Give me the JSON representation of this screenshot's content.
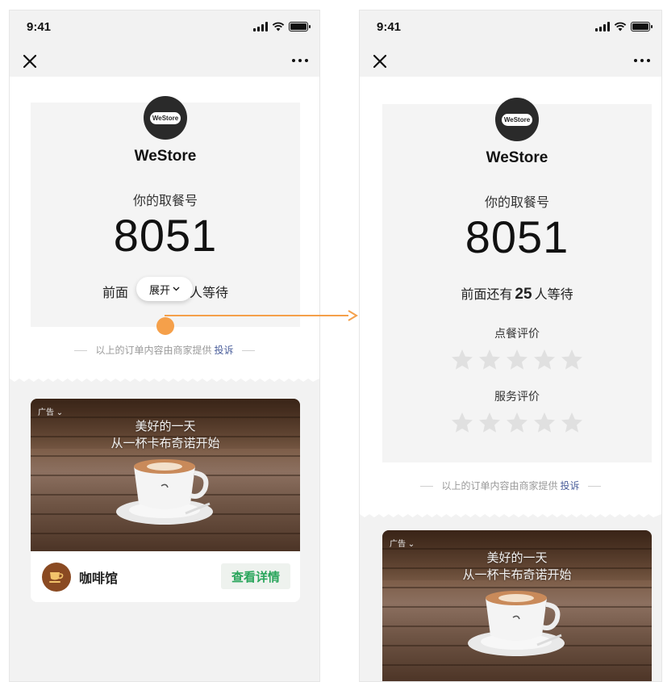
{
  "status_bar": {
    "time": "9:41"
  },
  "store": {
    "name": "WeStore",
    "logo_text": "WeStore"
  },
  "ticket": {
    "number_label": "你的取餐号",
    "number": "8051",
    "queue_prefix_left": "前面",
    "queue_suffix_left": "人等待",
    "queue_prefix": "前面还有",
    "queue_count": "25",
    "queue_suffix": "人等待"
  },
  "expand_button": {
    "label": "展开"
  },
  "ratings": {
    "order_label": "点餐评价",
    "service_label": "服务评价",
    "order_stars": 0,
    "service_stars": 0,
    "max_stars": 5
  },
  "disclaimer": {
    "text": "以上的订单内容由商家提供",
    "link": "投诉"
  },
  "ad": {
    "tag": "广告",
    "slogan_line1": "美好的一天",
    "slogan_line2": "从一杯卡布奇诺开始",
    "shop_name": "咖啡馆",
    "cta_label": "查看详情"
  },
  "colors": {
    "accent_green": "#2aa55c",
    "link_blue": "#4a5e9a",
    "touch_orange": "#f5a04a",
    "star_gray": "#e0e0e0"
  },
  "icons": {
    "close": "close-icon",
    "more": "more-icon",
    "signal": "signal-icon",
    "wifi": "wifi-icon",
    "battery": "battery-icon",
    "expand": "chevron-down-icon",
    "star": "star-icon",
    "cup": "coffee-cup-icon"
  }
}
